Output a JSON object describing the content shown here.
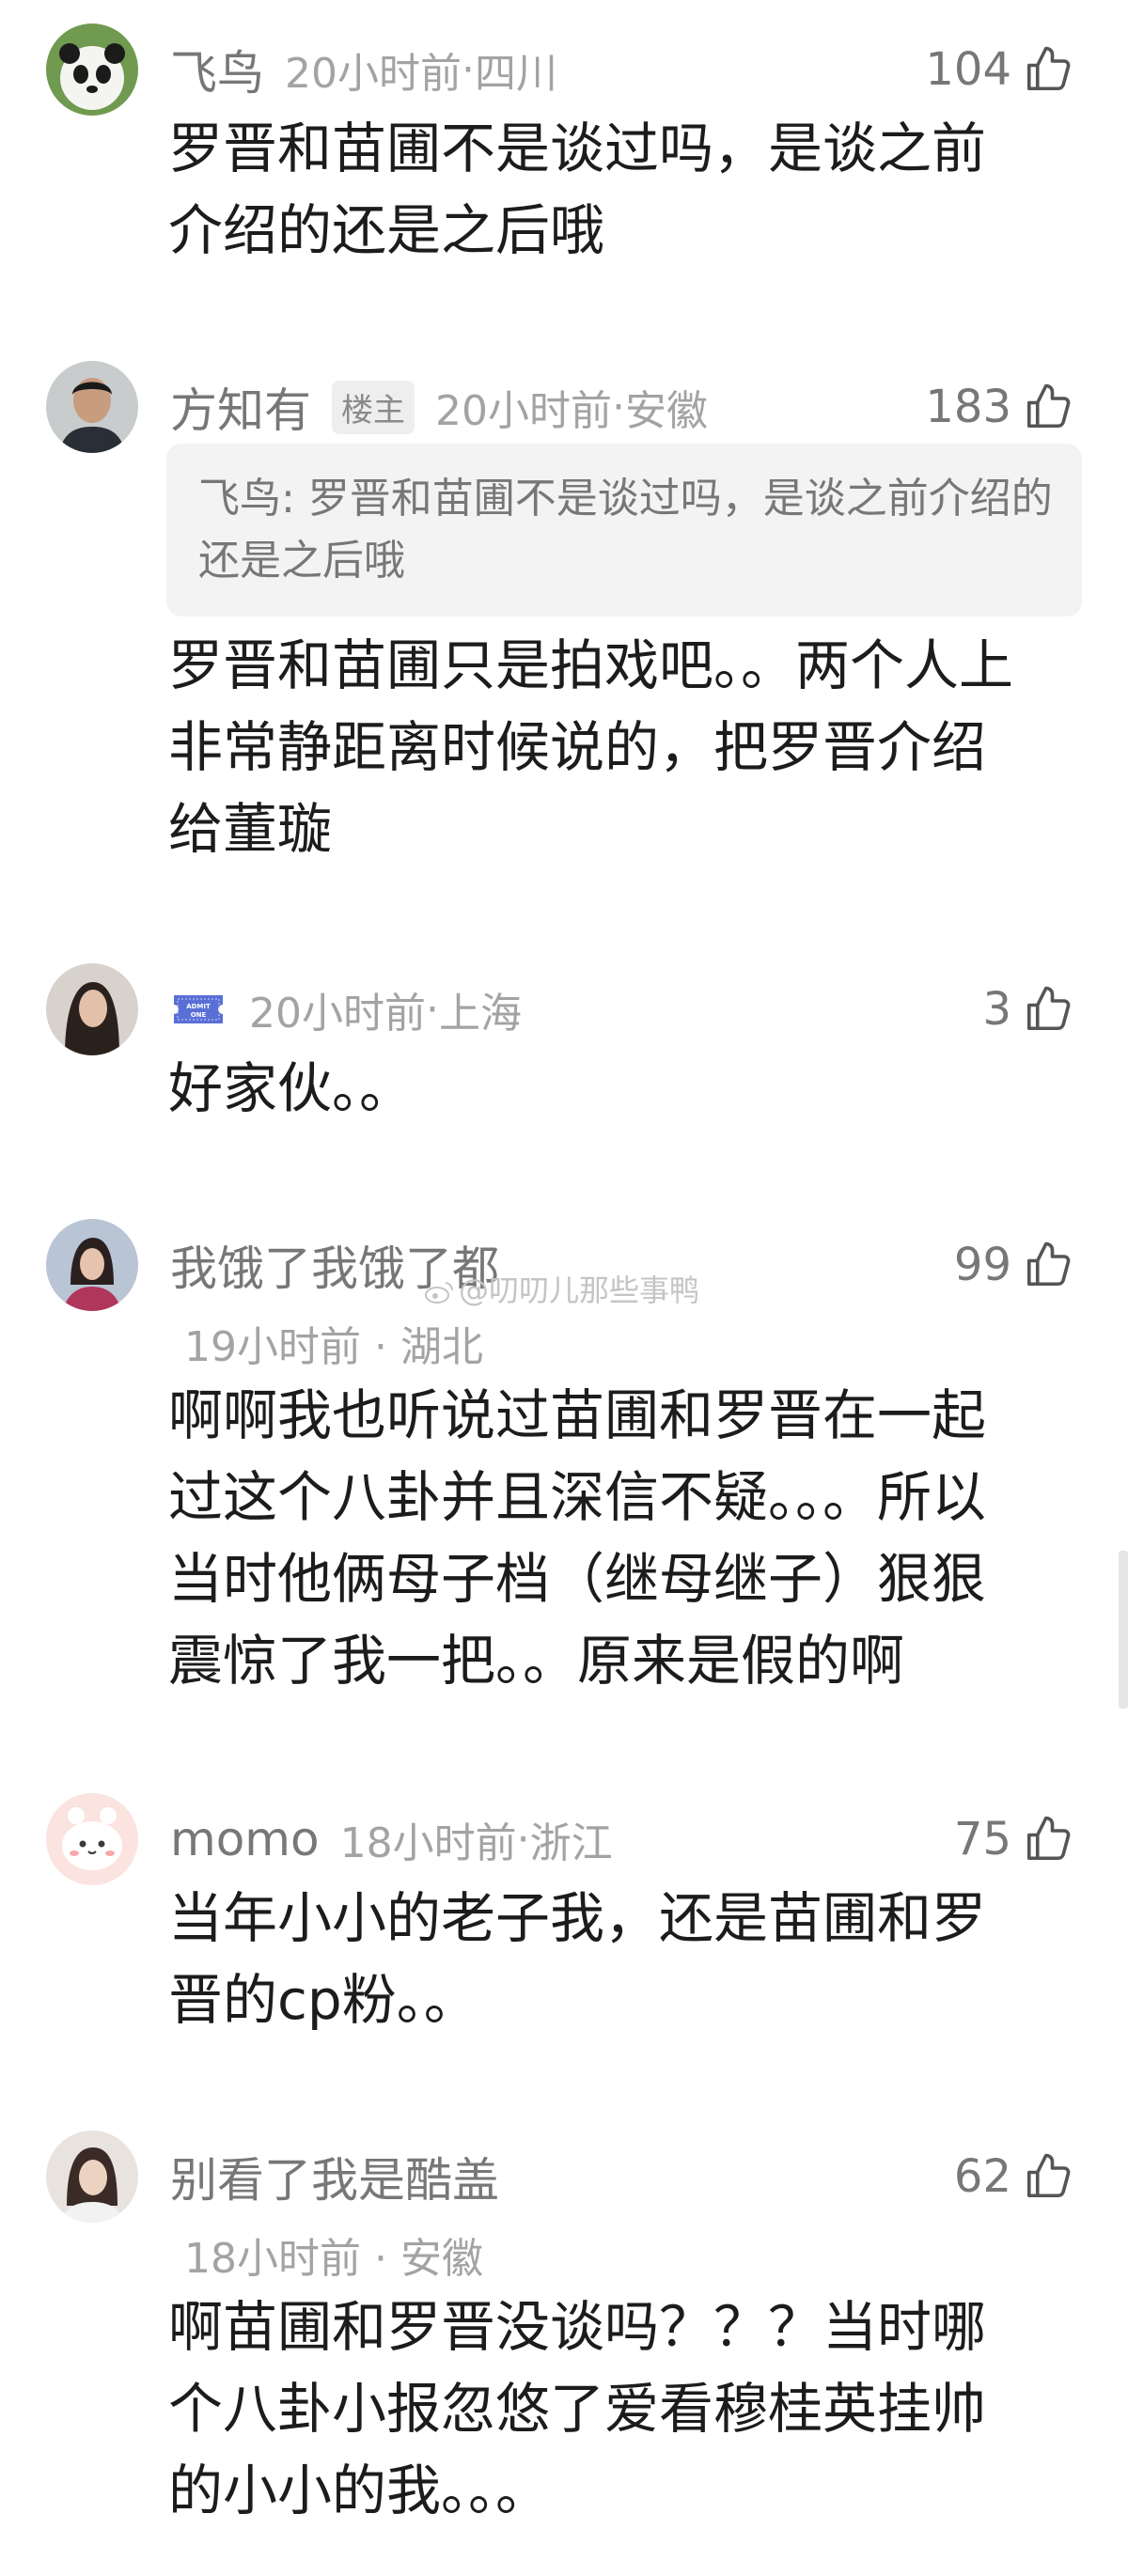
{
  "comments": [
    {
      "username": "飞鸟",
      "time": "20小时前",
      "location": "四川",
      "likes": "104",
      "text": "罗晋和苗圃不是谈过吗，是谈之前介绍的还是之后哦"
    },
    {
      "username": "方知有",
      "badge": "楼主",
      "time": "20小时前",
      "location": "安徽",
      "likes": "183",
      "quote": "飞鸟: 罗晋和苗圃不是谈过吗，是谈之前介绍的还是之后哦",
      "text": "罗晋和苗圃只是拍戏吧。。两个人上非常静距离时候说的，把罗晋介绍给董璇"
    },
    {
      "username": "",
      "badge_icon": "admit-one-ticket-icon",
      "time": "20小时前",
      "location": "上海",
      "likes": "3",
      "text": "好家伙。。"
    },
    {
      "username": "我饿了我饿了都",
      "time": "19小时前",
      "location": "湖北",
      "likes": "99",
      "text": "啊啊我也听说过苗圃和罗晋在一起过这个八卦并且深信不疑。。。所以当时他俩母子档（继母继子）狠狠震惊了我一把。。原来是假的啊"
    },
    {
      "username": "momo",
      "time": "18小时前",
      "location": "浙江",
      "likes": "75",
      "text": "当年小小的老子我，还是苗圃和罗晋的cp粉。。"
    },
    {
      "username": "别看了我是酷盖",
      "time": "18小时前",
      "location": "安徽",
      "likes": "62",
      "text": "啊苗圃和罗晋没谈吗？？？当时哪个八卦小报忽悠了爱看穆桂英挂帅的小小的我。。。"
    }
  ],
  "ticket_label": "ADMIT ONE",
  "meta_separator": " · ",
  "watermark": "@叨叨儿那些事鸭",
  "colors": {
    "text_primary": "#1c1c1c",
    "text_secondary": "#777777",
    "text_meta": "#a3a3a3",
    "quote_bg": "#f3f3f3",
    "ticket_blue": "#5a6fd6"
  }
}
